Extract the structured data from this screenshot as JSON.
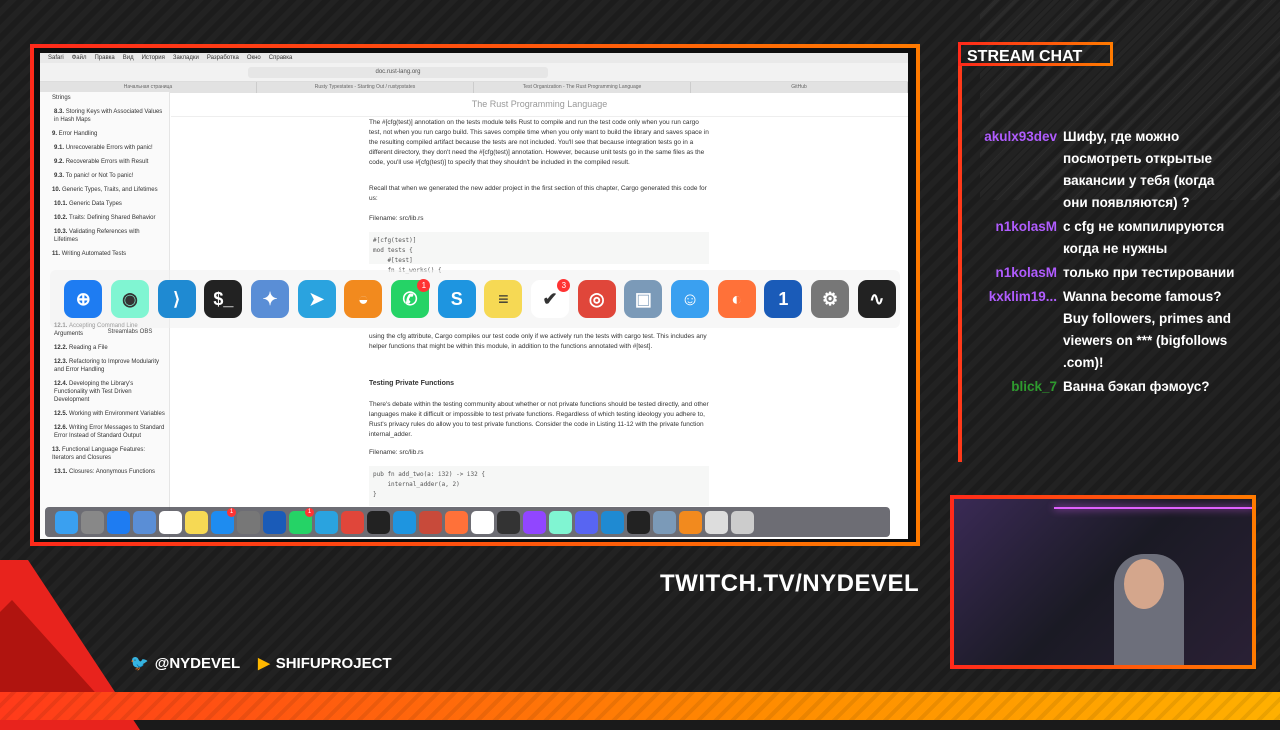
{
  "browser": {
    "menu": [
      "Safari",
      "Файл",
      "Правка",
      "Вид",
      "История",
      "Закладки",
      "Разработка",
      "Окно",
      "Справка"
    ],
    "url": "doc.rust-lang.org",
    "tabs": [
      "Начальная страница",
      "Rusty Typestates - Starting Out / rustypstates",
      "Test Organization - The Rust Programming Language",
      "GitHub"
    ]
  },
  "sidebar": {
    "items": [
      {
        "num": "",
        "text": "Strings"
      },
      {
        "num": "8.3.",
        "text": "Storing Keys with Associated Values in Hash Maps"
      },
      {
        "num": "9.",
        "text": "Error Handling"
      },
      {
        "num": "9.1.",
        "text": "Unrecoverable Errors with panic!"
      },
      {
        "num": "9.2.",
        "text": "Recoverable Errors with Result"
      },
      {
        "num": "9.3.",
        "text": "To panic! or Not To panic!"
      },
      {
        "num": "10.",
        "text": "Generic Types, Traits, and Lifetimes"
      },
      {
        "num": "10.1.",
        "text": "Generic Data Types"
      },
      {
        "num": "10.2.",
        "text": "Traits: Defining Shared Behavior"
      },
      {
        "num": "10.3.",
        "text": "Validating References with Lifetimes"
      },
      {
        "num": "11.",
        "text": "Writing Automated Tests"
      }
    ],
    "items2": [
      {
        "num": "12.1.",
        "text": "Accepting Command Line Arguments"
      },
      {
        "num": "12.2.",
        "text": "Reading a File"
      },
      {
        "num": "12.3.",
        "text": "Refactoring to Improve Modularity and Error Handling"
      },
      {
        "num": "12.4.",
        "text": "Developing the Library's Functionality with Test Driven Development"
      },
      {
        "num": "12.5.",
        "text": "Working with Environment Variables"
      },
      {
        "num": "12.6.",
        "text": "Writing Error Messages to Standard Error Instead of Standard Output"
      },
      {
        "num": "13.",
        "text": "Functional Language Features: Iterators and Closures"
      },
      {
        "num": "13.1.",
        "text": "Closures: Anonymous Functions"
      }
    ]
  },
  "content": {
    "book_title": "The Rust Programming Language",
    "p1": "The #[cfg(test)] annotation on the tests module tells Rust to compile and run the test code only when you run cargo test, not when you run cargo build. This saves compile time when you only want to build the library and saves space in the resulting compiled artifact because the tests are not included. You'll see that because integration tests go in a different directory, they don't need the #[cfg(test)] annotation. However, because unit tests go in the same files as the code, you'll use #[cfg(test)] to specify that they shouldn't be included in the compiled result.",
    "p2": "Recall that when we generated the new adder project in the first section of this chapter, Cargo generated this code for us:",
    "filename1": "Filename: src/lib.rs",
    "code1": [
      "#[cfg(test)]",
      "mod tests {",
      "    #[test]",
      "    fn it_works() {"
    ],
    "p3": "using the cfg attribute, Cargo compiles our test code only if we actively run the tests with cargo test. This includes any helper functions that might be within this module, in addition to the functions annotated with #[test].",
    "h_private": "Testing Private Functions",
    "p4": "There's debate within the testing community about whether or not private functions should be tested directly, and other languages make it difficult or impossible to test private functions. Regardless of which testing ideology you adhere to, Rust's privacy rules do allow you to test private functions. Consider the code in Listing 11-12 with the private function internal_adder.",
    "filename2": "Filename: src/lib.rs",
    "code2": [
      "pub fn add_two(a: i32) -> i32 {",
      "    internal_adder(a, 2)",
      "}"
    ]
  },
  "launcher": {
    "apps": [
      {
        "name": "safari-icon",
        "glyph": "⊕",
        "color": "#1e7cf2",
        "badge": ""
      },
      {
        "name": "streamlabs-obs-icon",
        "glyph": "◉",
        "color": "#80f5d2",
        "badge": "",
        "label": "Streamlabs OBS"
      },
      {
        "name": "vscode-icon",
        "glyph": "⟩",
        "color": "#1f8ad2",
        "badge": ""
      },
      {
        "name": "terminal-icon",
        "glyph": "$_",
        "color": "#222",
        "badge": ""
      },
      {
        "name": "preview-icon",
        "glyph": "✦",
        "color": "#5a8ed6",
        "badge": ""
      },
      {
        "name": "telegram-icon",
        "glyph": "➤",
        "color": "#2aa3df",
        "badge": ""
      },
      {
        "name": "vpn-icon",
        "glyph": "◒",
        "color": "#f28a1e",
        "badge": ""
      },
      {
        "name": "whatsapp-icon",
        "glyph": "✆",
        "color": "#25d366",
        "badge": "1"
      },
      {
        "name": "skype-icon",
        "glyph": "S",
        "color": "#1e95e0",
        "badge": ""
      },
      {
        "name": "notes-icon",
        "glyph": "≡",
        "color": "#f6d954",
        "badge": ""
      },
      {
        "name": "tasks-icon",
        "glyph": "✔",
        "color": "#ffffff",
        "badge": "3"
      },
      {
        "name": "chrome-icon",
        "glyph": "◎",
        "color": "#e0463a",
        "badge": ""
      },
      {
        "name": "image-viewer-icon",
        "glyph": "▣",
        "color": "#7b9ab8",
        "badge": ""
      },
      {
        "name": "finder-icon",
        "glyph": "☺",
        "color": "#3aa0f0",
        "badge": ""
      },
      {
        "name": "firefox-icon",
        "glyph": "◐",
        "color": "#ff7139",
        "badge": ""
      },
      {
        "name": "1password-icon",
        "glyph": "1",
        "color": "#1a5bb8",
        "badge": ""
      },
      {
        "name": "system-preferences-icon",
        "glyph": "⚙",
        "color": "#777",
        "badge": ""
      },
      {
        "name": "activity-monitor-icon",
        "glyph": "∿",
        "color": "#222",
        "badge": ""
      }
    ]
  },
  "dock": {
    "icons": [
      {
        "name": "finder-dock-icon",
        "color": "#3aa0f0",
        "badge": ""
      },
      {
        "name": "launchpad-dock-icon",
        "color": "#888",
        "badge": ""
      },
      {
        "name": "safari-dock-icon",
        "color": "#1e7cf2",
        "badge": ""
      },
      {
        "name": "preview-dock-icon",
        "color": "#5a8ed6",
        "badge": ""
      },
      {
        "name": "calendar-dock-icon",
        "color": "#fff",
        "badge": ""
      },
      {
        "name": "notes-dock-icon",
        "color": "#f6d954",
        "badge": ""
      },
      {
        "name": "app-store-dock-icon",
        "color": "#1e8cf0",
        "badge": "1"
      },
      {
        "name": "settings-dock-icon",
        "color": "#777",
        "badge": ""
      },
      {
        "name": "1password-dock-icon",
        "color": "#1a5bb8",
        "badge": ""
      },
      {
        "name": "whatsapp-dock-icon",
        "color": "#25d366",
        "badge": "1"
      },
      {
        "name": "telegram-dock-icon",
        "color": "#2aa3df",
        "badge": ""
      },
      {
        "name": "chrome-dock-icon",
        "color": "#e0463a",
        "badge": ""
      },
      {
        "name": "terminal-dock-icon",
        "color": "#222",
        "badge": ""
      },
      {
        "name": "skype-dock-icon",
        "color": "#1e95e0",
        "badge": ""
      },
      {
        "name": "dbeaver-dock-icon",
        "color": "#c84a3a",
        "badge": ""
      },
      {
        "name": "firefox-dock-icon",
        "color": "#ff7139",
        "badge": ""
      },
      {
        "name": "tasks-dock-icon",
        "color": "#ffffff",
        "badge": ""
      },
      {
        "name": "obs-dock-icon",
        "color": "#333",
        "badge": ""
      },
      {
        "name": "twitch-dock-icon",
        "color": "#9146ff",
        "badge": ""
      },
      {
        "name": "streamlabs-dock-icon",
        "color": "#80f5d2",
        "badge": ""
      },
      {
        "name": "discord-dock-icon",
        "color": "#5865f2",
        "badge": ""
      },
      {
        "name": "vscode-dock-icon",
        "color": "#1f8ad2",
        "badge": ""
      },
      {
        "name": "activity-monitor-dock-icon",
        "color": "#222",
        "badge": ""
      },
      {
        "name": "image-viewer-dock-icon",
        "color": "#7b9ab8",
        "badge": ""
      },
      {
        "name": "vpn-dock-icon",
        "color": "#f28a1e",
        "badge": ""
      },
      {
        "name": "documents-dock-icon",
        "color": "#ddd",
        "badge": ""
      },
      {
        "name": "trash-dock-icon",
        "color": "#ccc",
        "badge": ""
      }
    ]
  },
  "chat": {
    "title": "STREAM CHAT",
    "messages": [
      {
        "user": "akulx93dev",
        "color": "#b05cff",
        "text": "Шифу, где можно посмотреть открытые вакансии у тебя (когда они появляются) ?"
      },
      {
        "user": "n1kolasM",
        "color": "#b05cff",
        "text": "с cfg не компилируются когда не нужны"
      },
      {
        "user": "n1kolasM",
        "color": "#b05cff",
        "text": "только при тестировании"
      },
      {
        "user": "kxklim19...",
        "color": "#b05cff",
        "text": "Wanna become famous? Buy followers, primes and viewers on *** (bigfollows .com)!"
      },
      {
        "user": "blick_7",
        "color": "#2e9a2e",
        "text": "Ванна бэкап фэмоус?"
      }
    ]
  },
  "overlay": {
    "twitch": "TWITCH.TV/NYDEVEL",
    "twitter": "@NYDEVEL",
    "youtube": "SHIFUPROJECT"
  }
}
